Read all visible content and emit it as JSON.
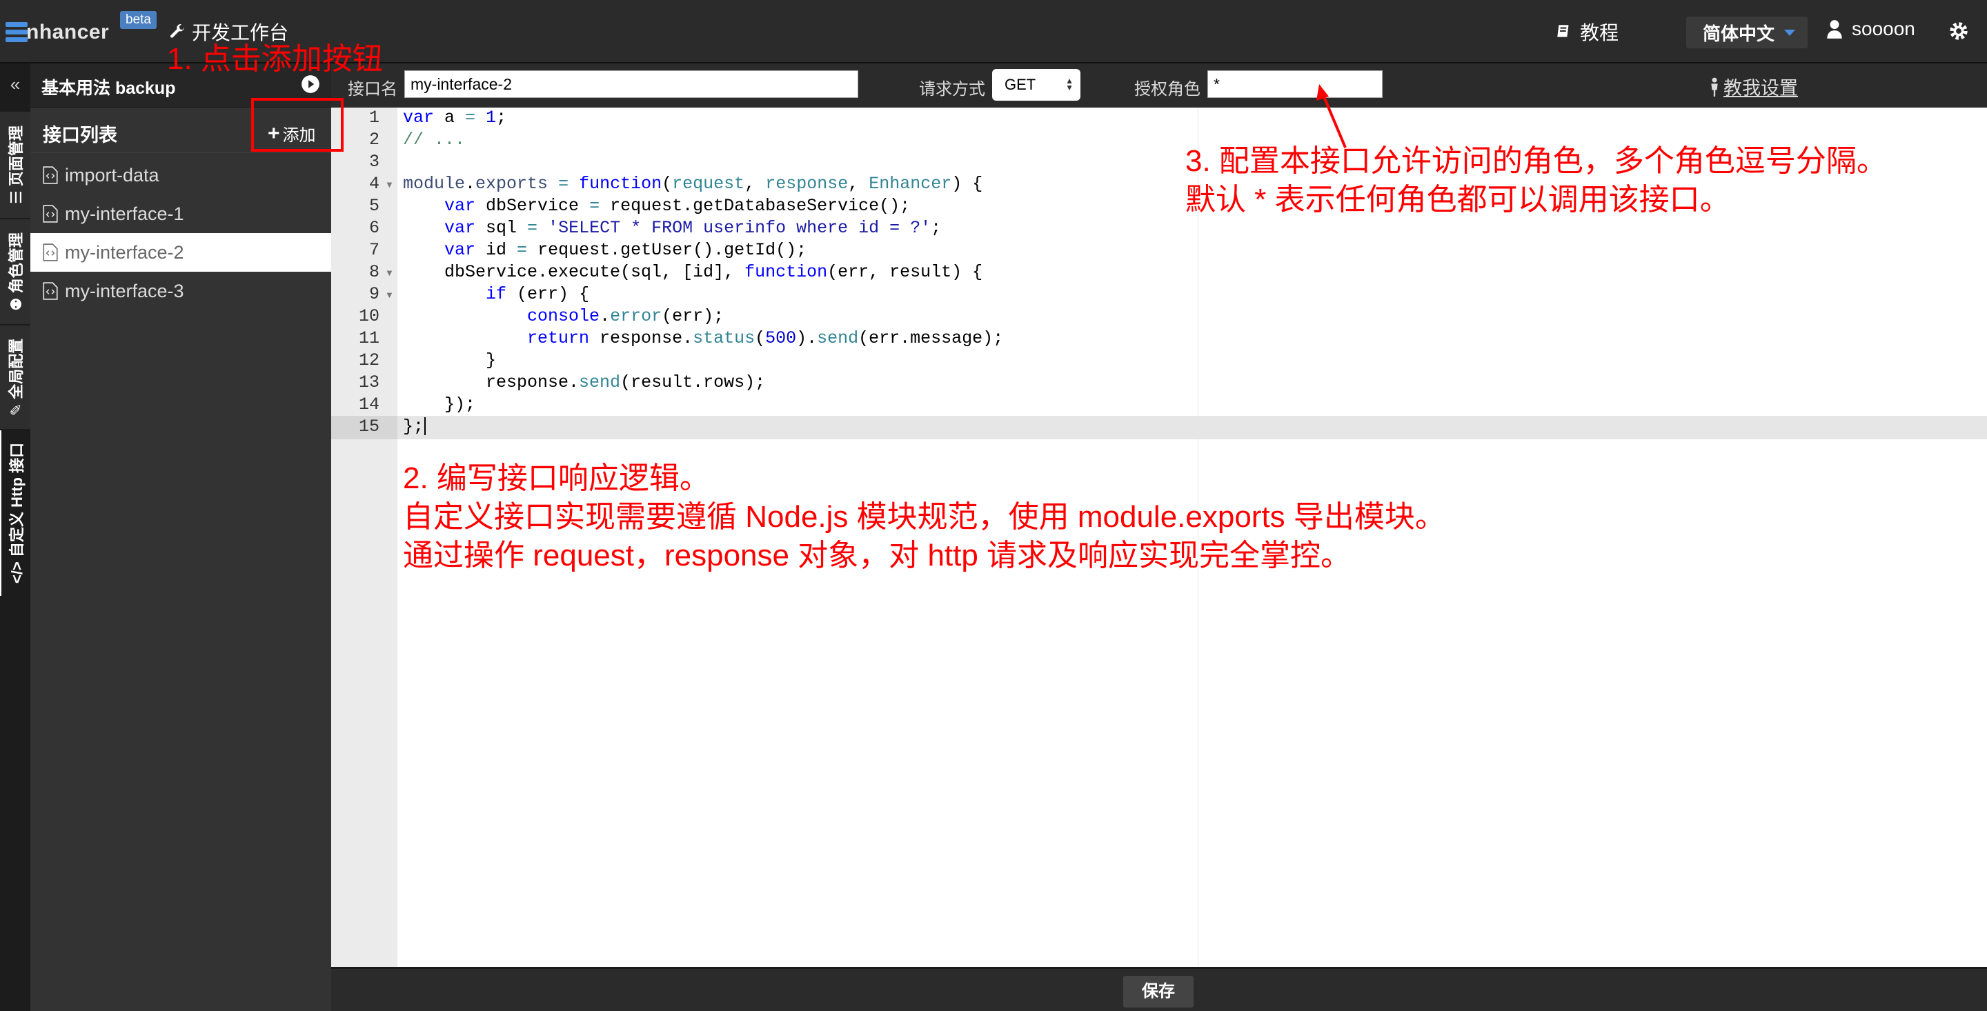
{
  "header": {
    "brand": "nhancer",
    "beta": "beta",
    "workbench": "开发工作台",
    "tutorial": "教程",
    "language": "简体中文",
    "username": "soooon"
  },
  "vertical_tabs": [
    {
      "label": "页面管理",
      "icon": "list-icon"
    },
    {
      "label": "角色管理",
      "icon": "users-icon"
    },
    {
      "label": "全局配置",
      "icon": "wrench-icon"
    },
    {
      "label": "自定义 Http 接口",
      "icon": "code-icon"
    }
  ],
  "sidebar": {
    "project": "基本用法 backup",
    "list_title": "接口列表",
    "add_label": "添加",
    "items": [
      {
        "label": "import-data"
      },
      {
        "label": "my-interface-1"
      },
      {
        "label": "my-interface-2",
        "active": true
      },
      {
        "label": "my-interface-3"
      }
    ]
  },
  "form": {
    "name_label": "接口名",
    "name_value": "my-interface-2",
    "method_label": "请求方式",
    "method_value": "GET",
    "role_label": "授权角色",
    "role_value": "*",
    "help_link": "教我设置"
  },
  "editor": {
    "line_numbers": [
      "1",
      "2",
      "3",
      "4",
      "5",
      "6",
      "7",
      "8",
      "9",
      "10",
      "11",
      "12",
      "13",
      "14",
      "15"
    ],
    "fold_lines": [
      4,
      8,
      9
    ],
    "active_line": 15
  },
  "save_label": "保存",
  "annotations": {
    "step1": "1. 点击添加按钮",
    "step2": [
      "2. 编写接口响应逻辑。",
      "自定义接口实现需要遵循 Node.js 模块规范，使用 module.exports 导出模块。",
      "通过操作 request，response 对象，对 http 请求及响应实现完全掌控。"
    ],
    "step3": [
      "3. 配置本接口允许访问的角色，多个角色逗号分隔。",
      "默认 * 表示任何角色都可以调用该接口。"
    ]
  },
  "colors": {
    "accent": "#4a90e2",
    "annotation": "#ff0000",
    "header_bg": "#2b2b2b",
    "sidebar_bg": "#333333"
  }
}
